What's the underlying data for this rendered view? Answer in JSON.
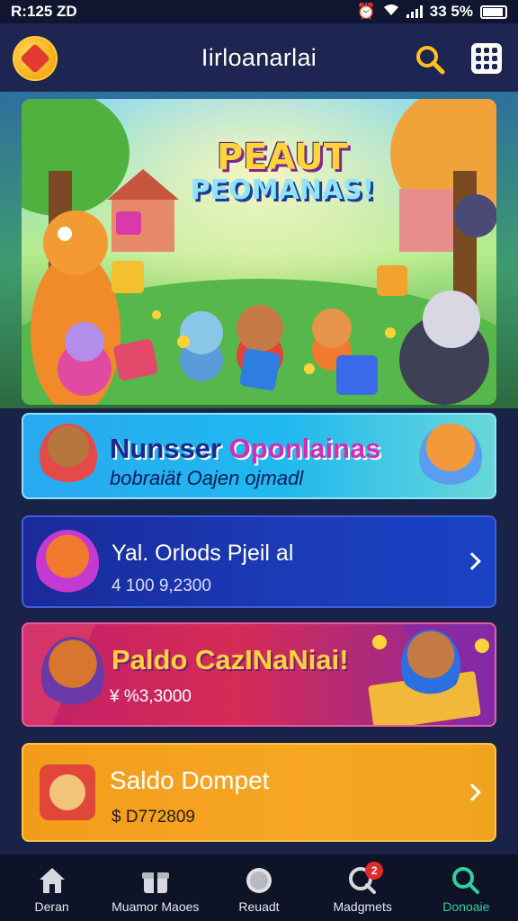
{
  "status_bar": {
    "time": "R:125 ZD",
    "battery": "33 5%"
  },
  "header": {
    "title": "Iirloanarlai",
    "logo_icon": "app-logo-icon",
    "search_icon": "search-icon",
    "menu_icon": "grid-menu-icon"
  },
  "hero": {
    "title_line1": "PEAUT",
    "title_line2": "PEOMANAS!"
  },
  "cards": {
    "card1": {
      "title_part1": "Nunsser",
      "title_part2": "Oponlainas",
      "subtitle": "bobraiät Oajen ojmadl"
    },
    "card2": {
      "title": "Yal. Orlods Pjeil al",
      "subtitle": "4 100 9,2300"
    },
    "card3": {
      "title": "Paldo CazINaNiai!",
      "subtitle": "¥ %3,3000"
    },
    "card4": {
      "title": "Saldo Dompet",
      "subtitle": "$ D772809"
    }
  },
  "bottom_nav": {
    "items": [
      {
        "label": "Deran",
        "icon": "home-icon"
      },
      {
        "label": "Muamor Maoes",
        "icon": "gift-icon"
      },
      {
        "label": "Reuadt",
        "icon": "coin-icon"
      },
      {
        "label": "Madgmets",
        "icon": "chat-icon",
        "badge": "2"
      },
      {
        "label": "Donoaie",
        "icon": "search-icon"
      }
    ]
  },
  "colors": {
    "background": "#1b2247",
    "accent_green": "#2fd09a",
    "card_cyan": "#29a9f2",
    "card_blue": "#1b3cb8",
    "card_pink": "#d52b56",
    "card_orange": "#f6a723"
  }
}
